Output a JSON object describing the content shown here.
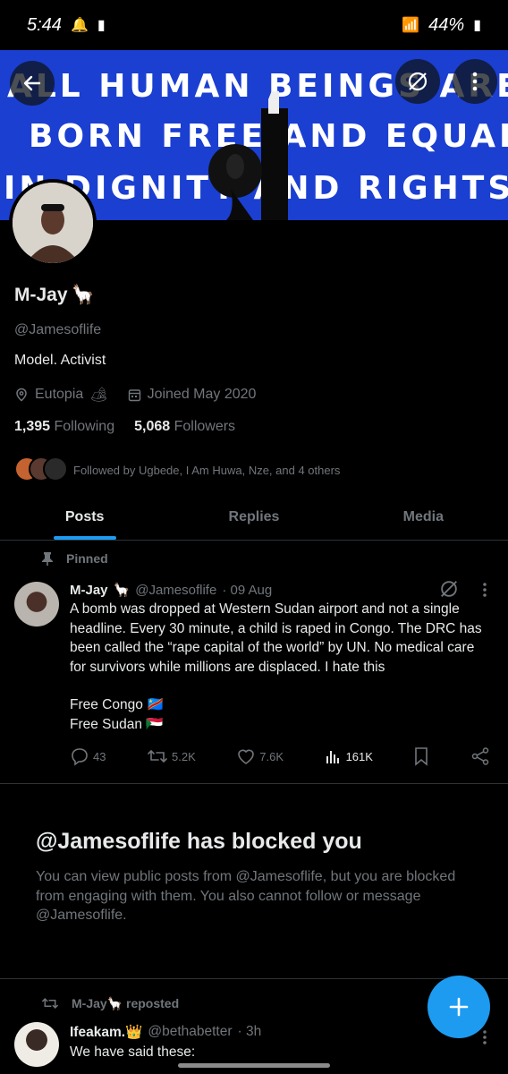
{
  "status_bar": {
    "time": "5:44",
    "battery": "44%"
  },
  "banner": {
    "line1": "ALL HUMAN BEINGS ARE",
    "line2": "BORN FREE AND EQUAL",
    "line3": "IN DIGNITY AND RIGHTS.",
    "bg_color": "#1a3fd1"
  },
  "profile": {
    "name": "M-Jay",
    "name_emoji": "🦙",
    "handle": "@Jamesoflife",
    "bio": "Model. Activist",
    "location": "Eutopia",
    "location_emoji": "🏕",
    "joined": "Joined May 2020",
    "following_count": "1,395",
    "following_label": "Following",
    "followers_count": "5,068",
    "followers_label": "Followers",
    "followed_by": "Followed by Ugbede, I Am Huwa, Nze, and 4 others"
  },
  "tabs": [
    {
      "label": "Posts",
      "active": true
    },
    {
      "label": "Replies",
      "active": false
    },
    {
      "label": "Media",
      "active": false
    }
  ],
  "pinned_post": {
    "pinned_label": "Pinned",
    "author_name": "M-Jay",
    "author_emoji": "🦙",
    "author_handle": "@Jamesoflife",
    "date": "· 09 Aug",
    "text": "A bomb was dropped at Western Sudan airport and not a single headline. Every 30 minute, a child is raped in Congo. The DRC has been called the “rape capital of the world” by UN. No medical care for survivors while millions are displaced. I hate this",
    "line2": "Free Congo 🇨🇩",
    "line3": "Free Sudan 🇸🇩",
    "replies": "43",
    "reposts": "5.2K",
    "likes": "7.6K",
    "views": "161K"
  },
  "blocked_notice": {
    "title": "@Jamesoflife has blocked you",
    "body": "You can view public posts from @Jamesoflife, but you are blocked from engaging with them. You also cannot follow or message @Jamesoflife."
  },
  "repost": {
    "reposted_by": "M-Jay🦙 reposted",
    "author_name": "Ifeakam.👑",
    "author_handle": "@bethabetter",
    "time": "· 3h",
    "text": "We have said these:"
  },
  "colors": {
    "accent": "#1d9bf0",
    "muted": "#71767b",
    "text": "#e7e9ea",
    "divider": "#2f3336"
  }
}
